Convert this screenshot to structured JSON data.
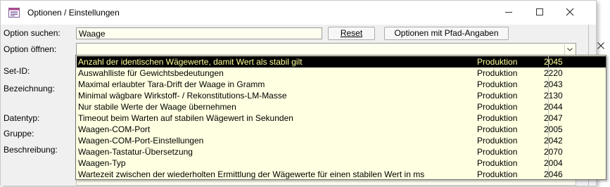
{
  "window": {
    "title": "Optionen / Einstellungen"
  },
  "form": {
    "search_label": "Option suchen:",
    "search_value": "Waage",
    "reset_label": "Reset",
    "path_button_label": "Optionen mit Pfad-Angaben",
    "open_label": "Option öffnen:",
    "open_value": ""
  },
  "fields": {
    "set_id_label": "Set-ID:",
    "bezeichnung_label": "Bezeichnung:",
    "datentyp_label": "Datentyp:",
    "gruppe_label": "Gruppe:",
    "beschreibung_label": "Beschreibung:"
  },
  "dropdown": {
    "rows": [
      {
        "name": "Anzahl der identischen Wägewerte, damit Wert als stabil gilt",
        "group": "Produktion",
        "id": "2045",
        "selected": true
      },
      {
        "name": "Auswahlliste für Gewichtsbedeutungen",
        "group": "Produktion",
        "id": "2220"
      },
      {
        "name": "Maximal erlaubter Tara-Drift der Waage in Gramm",
        "group": "Produktion",
        "id": "2043"
      },
      {
        "name": "Minimal wägbare Wirkstoff- / Rekonstitutions-LM-Masse",
        "group": "Produktion",
        "id": "2130"
      },
      {
        "name": "Nur stabile Werte der Waage übernehmen",
        "group": "Produktion",
        "id": "2044"
      },
      {
        "name": "Timeout beim Warten auf stabilen Wägewert in Sekunden",
        "group": "Produktion",
        "id": "2047"
      },
      {
        "name": "Waagen-COM-Port",
        "group": "Produktion",
        "id": "2005"
      },
      {
        "name": "Waagen-COM-Port-Einstellungen",
        "group": "Produktion",
        "id": "2042"
      },
      {
        "name": "Waagen-Tastatur-Übersetzung",
        "group": "Produktion",
        "id": "2070"
      },
      {
        "name": "Waagen-Typ",
        "group": "Produktion",
        "id": "2004"
      },
      {
        "name": "Wartezeit zwischen der wiederholten Ermittlung der Wägewerte für einen stabilen Wert in ms",
        "group": "Produktion",
        "id": "2046"
      }
    ]
  },
  "colors": {
    "field_bg": "#fffff0",
    "dropdown_bg": "#ffffe1",
    "selected_bg": "#000000",
    "selected_fg": "#ffff99"
  }
}
